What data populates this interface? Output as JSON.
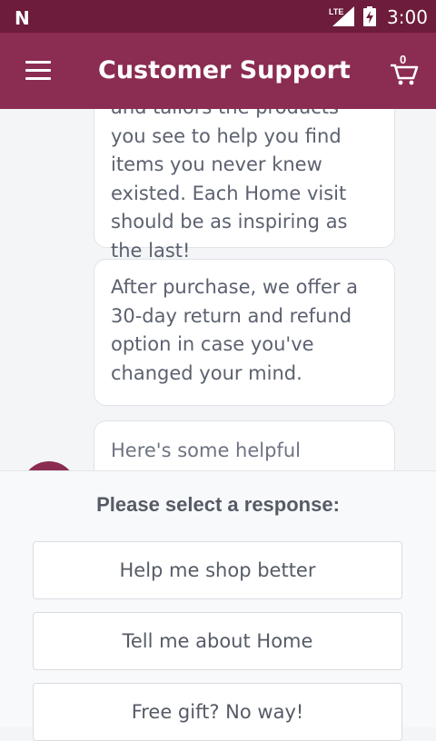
{
  "status_bar": {
    "carrier_logo": "N",
    "network": "LTE",
    "time": "3:00",
    "icons": [
      "signal-icon",
      "battery-charging-icon"
    ]
  },
  "app_bar": {
    "title": "Customer Support",
    "cart_count": "0",
    "icons": [
      "menu-icon",
      "cart-icon"
    ]
  },
  "chat": {
    "messages": [
      {
        "text": "and tailors the products you see to help you find items you never knew existed. Each Home visit should be as inspiring as the last!"
      },
      {
        "text": "After purchase, we offer a 30-day return and refund option in case you've changed your mind."
      },
      {
        "text": "Here's some helpful"
      }
    ]
  },
  "responses": {
    "prompt": "Please select a response:",
    "options": [
      "Help me shop better",
      "Tell me about Home",
      "Free gift? No way!"
    ]
  },
  "colors": {
    "status_bar": "#6d1c3b",
    "app_bar": "#8b2c52",
    "background": "#f4f5f7",
    "text": "#5c6170"
  }
}
